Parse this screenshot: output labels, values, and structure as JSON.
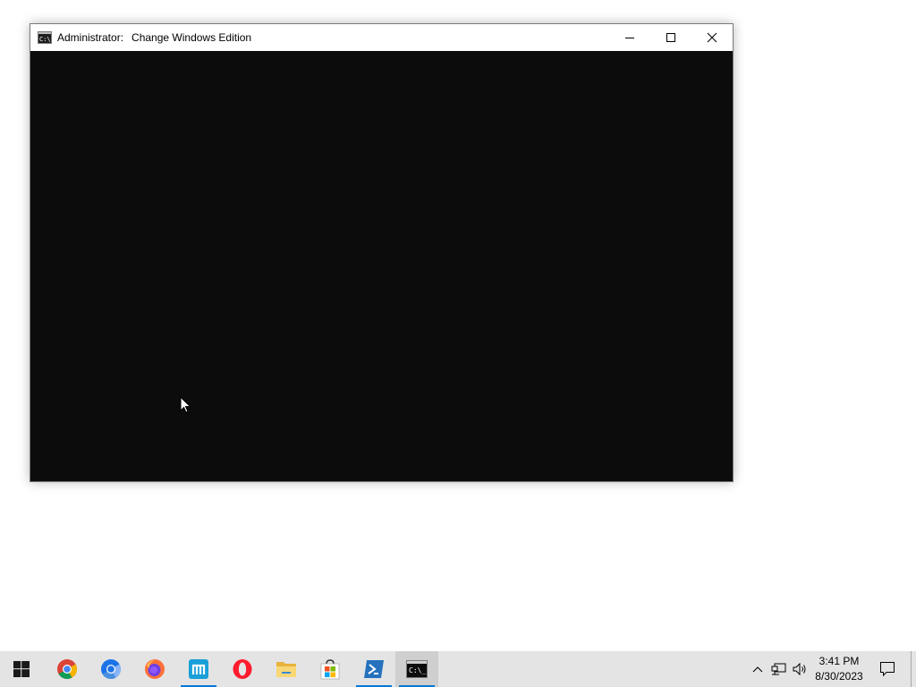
{
  "window": {
    "title_user": "Administrator:",
    "title_app": "Change Windows Edition",
    "icon": "cmd-icon",
    "controls": {
      "minimize": "minimize-icon",
      "maximize": "maximize-icon",
      "close": "close-icon"
    },
    "console_bg": "#0c0c0c"
  },
  "taskbar": {
    "start_icon": "windows-start-icon",
    "apps": [
      {
        "name": "Google Chrome",
        "icon": "chrome-icon",
        "running": false
      },
      {
        "name": "Chromium",
        "icon": "chromium-icon",
        "running": false
      },
      {
        "name": "Firefox",
        "icon": "firefox-icon",
        "running": false
      },
      {
        "name": "Maxthon",
        "icon": "maxthon-icon",
        "running": true
      },
      {
        "name": "Opera",
        "icon": "opera-icon",
        "running": false
      },
      {
        "name": "File Explorer",
        "icon": "folder-icon",
        "running": false
      },
      {
        "name": "Microsoft Store",
        "icon": "store-icon",
        "running": false
      },
      {
        "name": "PowerShell",
        "icon": "powershell-icon",
        "running": true
      },
      {
        "name": "Command Prompt",
        "icon": "cmd-icon",
        "running": true,
        "focused": true
      }
    ],
    "tray": {
      "chevron": "chevron-up-icon",
      "network": "network-icon",
      "volume": "volume-icon",
      "notifications": "notification-icon"
    },
    "clock": {
      "time": "3:41 PM",
      "date": "8/30/2023"
    },
    "accent": "#0078d7",
    "background": "#e4e4e4"
  }
}
